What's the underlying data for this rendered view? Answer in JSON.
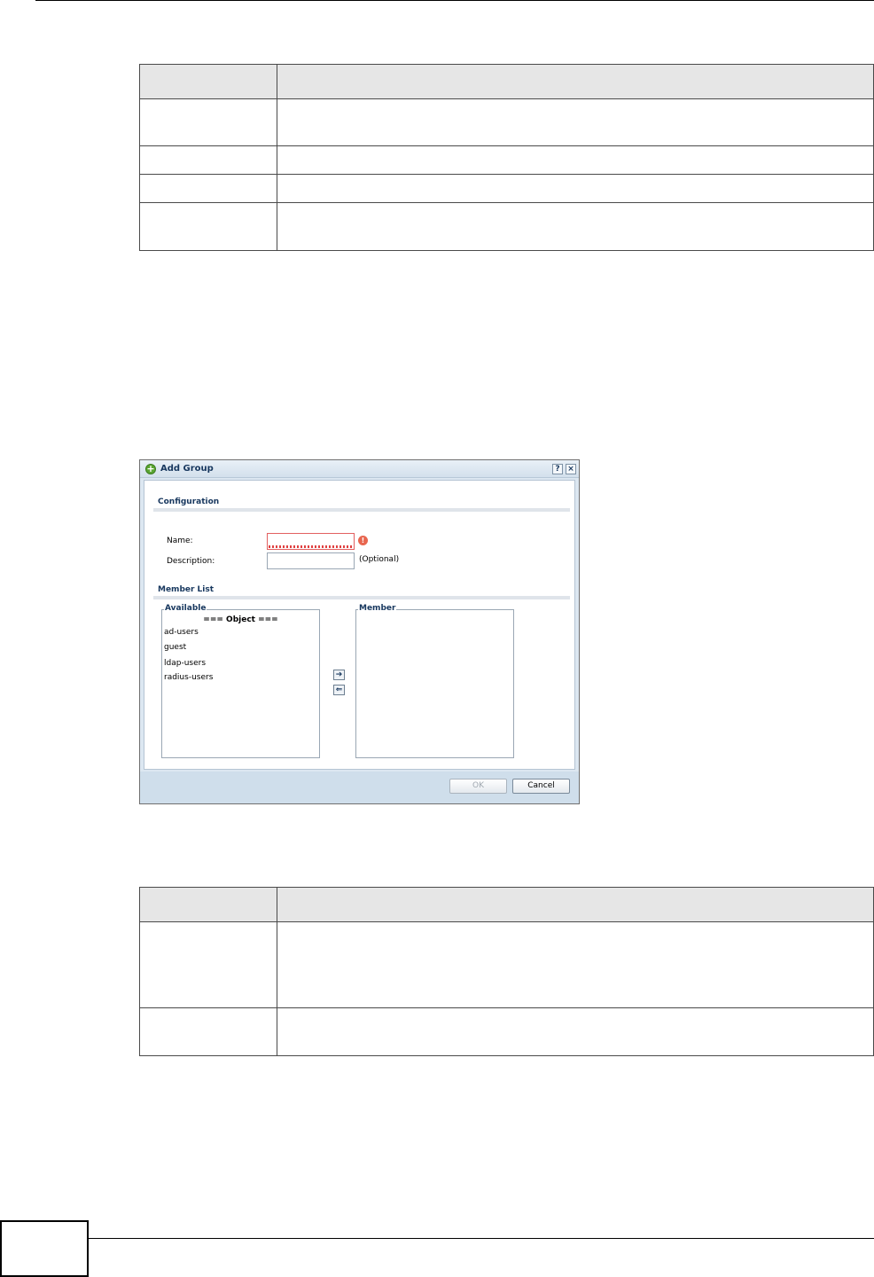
{
  "dialog": {
    "title": "Add Group",
    "help_label": "?",
    "close_label": "×",
    "configuration_title": "Configuration",
    "name_label": "Name:",
    "name_value": "",
    "name_error_icon": "!",
    "description_label": "Description:",
    "description_value": "",
    "optional_label": "(Optional)",
    "member_list_title": "Member List",
    "available_legend": "Available",
    "available_header": "=== Object ===",
    "available_items": [
      "ad-users",
      "guest",
      "ldap-users",
      "radius-users"
    ],
    "member_legend": "Member",
    "add_arrow": "➔",
    "remove_arrow": "⇐",
    "ok_label": "OK",
    "cancel_label": "Cancel"
  },
  "icons": {
    "title_icon": "add-icon",
    "error_icon": "error-icon",
    "add_member_icon": "arrow-right-icon",
    "remove_member_icon": "arrow-left-icon"
  },
  "colors": {
    "dialog_title_text": "#17375e",
    "error": "#e8664f",
    "dialog_frame": "#dce7f1"
  }
}
